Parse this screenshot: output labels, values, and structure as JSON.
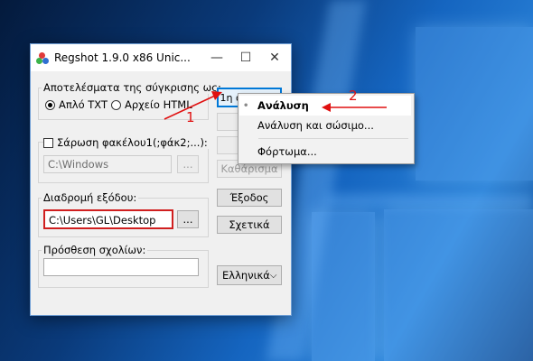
{
  "window": {
    "title": "Regshot 1.9.0 x86 Unic...",
    "minimize_glyph": "—",
    "maximize_glyph": "☐",
    "close_glyph": "✕"
  },
  "compare_output": {
    "label": "Αποτελέσματα της σύγκρισης ως:",
    "options": [
      "Απλό TXT",
      "Αρχείο HTML"
    ],
    "selected": "Απλό TXT"
  },
  "scan_folder": {
    "label": "Σάρωση φακέλου1(;φάκ2;...):",
    "checked": false,
    "path": "C:\\Windows",
    "browse_label": "..."
  },
  "output_path": {
    "label": "Διαδρομή εξόδου:",
    "path": "C:\\Users\\GL\\Desktop",
    "browse_label": "..."
  },
  "comment": {
    "label": "Πρόσθεση σχολίων:",
    "value": ""
  },
  "buttons": {
    "first_shot": "1η ανάλυση",
    "clear": "Καθάρισμα",
    "exit": "Έξοδος",
    "about": "Σχετικά",
    "language": "Ελληνικά"
  },
  "context_menu": {
    "items": [
      "Ανάλυση",
      "Ανάλυση και σώσιμο...",
      "Φόρτωμα..."
    ]
  },
  "annotations": {
    "step1": "1",
    "step2": "2",
    "color": "#e01010"
  }
}
